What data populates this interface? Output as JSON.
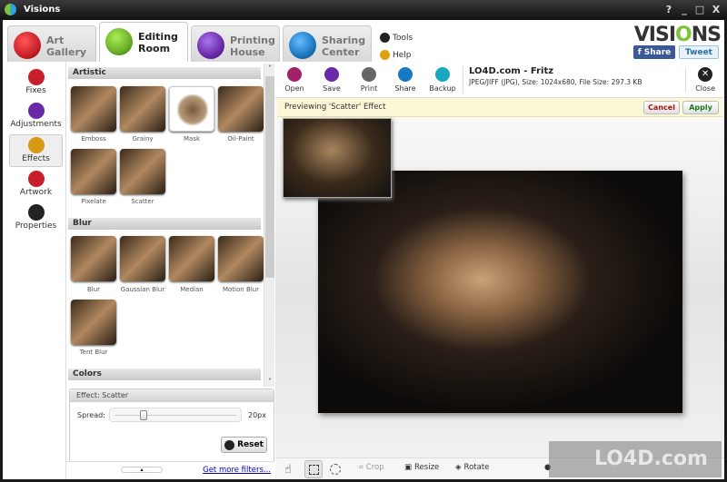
{
  "window": {
    "title": "Visions",
    "controls": [
      "?",
      "_",
      "□",
      "X"
    ]
  },
  "tabs": [
    {
      "label_line1": "Art",
      "label_line2": "Gallery",
      "icon": "gallery-icon",
      "color": "#c8202a"
    },
    {
      "label_line1": "Editing",
      "label_line2": "Room",
      "icon": "brush-icon",
      "color": "#6aae2a",
      "active": true
    },
    {
      "label_line1": "Printing",
      "label_line2": "House",
      "icon": "print-doc-icon",
      "color": "#6a2aa8"
    },
    {
      "label_line1": "Sharing",
      "label_line2": "Center",
      "icon": "share-arrows-icon",
      "color": "#1a78c0"
    }
  ],
  "links": {
    "tools": "Tools",
    "help": "Help"
  },
  "brand": {
    "pre": "VISI",
    "o": "O",
    "post": "NS"
  },
  "social": {
    "share": "f  Share",
    "tweet": "Tweet"
  },
  "nav": [
    {
      "label": "Fixes",
      "color": "#c8202a"
    },
    {
      "label": "Adjustments",
      "color": "#6a2aa8"
    },
    {
      "label": "Effects",
      "color": "#d89a10",
      "active": true
    },
    {
      "label": "Artwork",
      "color": "#c8202a"
    },
    {
      "label": "Properties",
      "color": "#222"
    }
  ],
  "sections": {
    "artistic": {
      "title": "Artistic",
      "items": [
        "Emboss",
        "Grainy",
        "Mask",
        "Oil-Paint",
        "Pixelate",
        "Scatter"
      ]
    },
    "blur": {
      "title": "Blur",
      "items": [
        "Blur",
        "Gaussian Blur",
        "Median",
        "Motion Blur",
        "Tent Blur"
      ]
    },
    "colors": {
      "title": "Colors"
    }
  },
  "effect": {
    "title": "Effect: Scatter",
    "param_label": "Spread:",
    "value": "20px",
    "slider_fraction": 0.22,
    "reset": "Reset"
  },
  "footer": {
    "more": "Get more filters..."
  },
  "toolbar": {
    "open": "Open",
    "save": "Save",
    "print": "Print",
    "share": "Share",
    "backup": "Backup",
    "close": "Close"
  },
  "file": {
    "name": "LO4D.com - Fritz",
    "details": "JPEG/JIFF (JPG), Size: 1024x680, File Size: 297.3 KB"
  },
  "preview": {
    "text": "Previewing 'Scatter' Effect",
    "cancel": "Cancel",
    "apply": "Apply"
  },
  "bottom": {
    "crop": "Crop",
    "resize": "Resize",
    "rotate": "Rotate"
  },
  "watermark": "LO4D.com"
}
